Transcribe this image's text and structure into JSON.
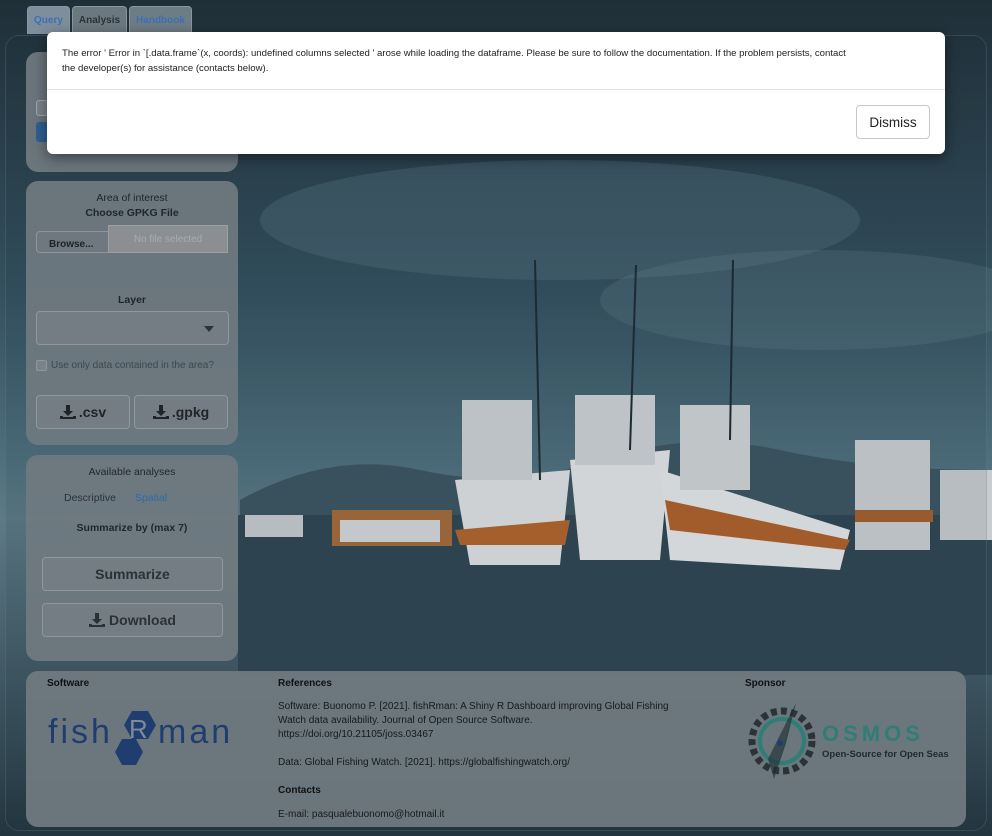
{
  "tabs": [
    {
      "label": "Query"
    },
    {
      "label": "Analysis"
    },
    {
      "label": "Handbook"
    }
  ],
  "area_panel": {
    "title": "Area of interest",
    "file_label": "Choose GPKG File",
    "browse_label": "Browse...",
    "file_placeholder": "No file selected",
    "layer_label": "Layer",
    "layer_value": "",
    "checkbox_label": "Use only data contained in the area?",
    "csv_label": ".csv",
    "gpkg_label": ".gpkg"
  },
  "analyses_panel": {
    "title": "Available analyses",
    "subtabs": [
      {
        "label": "Descriptive"
      },
      {
        "label": "Spatial"
      }
    ],
    "summarize_by_label": "Summarize by (max 7)",
    "summarize_button": "Summarize",
    "download_button": "Download"
  },
  "footer": {
    "software_heading": "Software",
    "software_logo_text": "fishRman",
    "references_heading": "References",
    "software_ref_lines": [
      "Software: Buonomo P. [2021]. fishRman: A Shiny R Dashboard improving Global Fishing",
      "Watch data availability. Journal of Open Source Software.",
      "https://doi.org/10.21105/joss.03467"
    ],
    "data_ref": "Data: Global Fishing Watch. [2021]. https://globalfishingwatch.org/",
    "contacts_heading": "Contacts",
    "email": "E-mail: pasqualebuonomo@hotmail.it",
    "sponsor_heading": "Sponsor",
    "sponsor_name": "OSMOS",
    "sponsor_tagline": "Open-Source for Open Seas"
  },
  "modal": {
    "message_line1": "The error ' Error in `[.data.frame`(x, coords): undefined columns selected ' arose while loading the dataframe. Please be sure to follow the documentation. If the problem persists, contact",
    "message_line2": "the developer(s) for assistance (contacts below).",
    "dismiss_label": "Dismiss"
  },
  "colors": {
    "accent_blue": "#3d6fb6",
    "logo_navy": "#1f3d6e",
    "osmos_teal": "#2e7d77"
  }
}
